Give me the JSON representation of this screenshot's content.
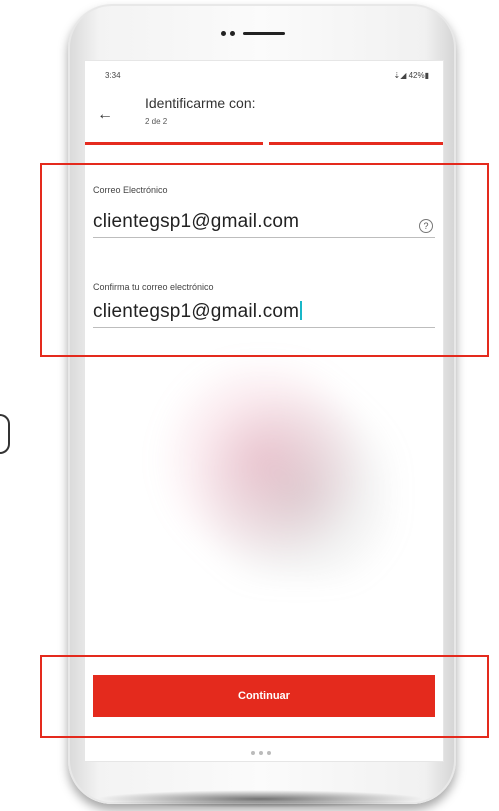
{
  "status_bar": {
    "time": "3:34",
    "icons": "⇣◢ 42%▮"
  },
  "header": {
    "title": "Identificarme con:",
    "step": "2 de 2"
  },
  "form": {
    "email_label": "Correo Electrónico",
    "email_value": "clientegsp1@gmail.com",
    "confirm_label": "Confirma tu correo electrónico",
    "confirm_value": "clientegsp1@gmail.com"
  },
  "continue_label": "Continuar",
  "help_symbol": "?",
  "back_symbol": "←",
  "colors": {
    "accent": "#e42a1d",
    "caret": "#19b7c8"
  },
  "icons": {
    "back": "back-arrow-icon",
    "help": "help-circle-icon"
  }
}
